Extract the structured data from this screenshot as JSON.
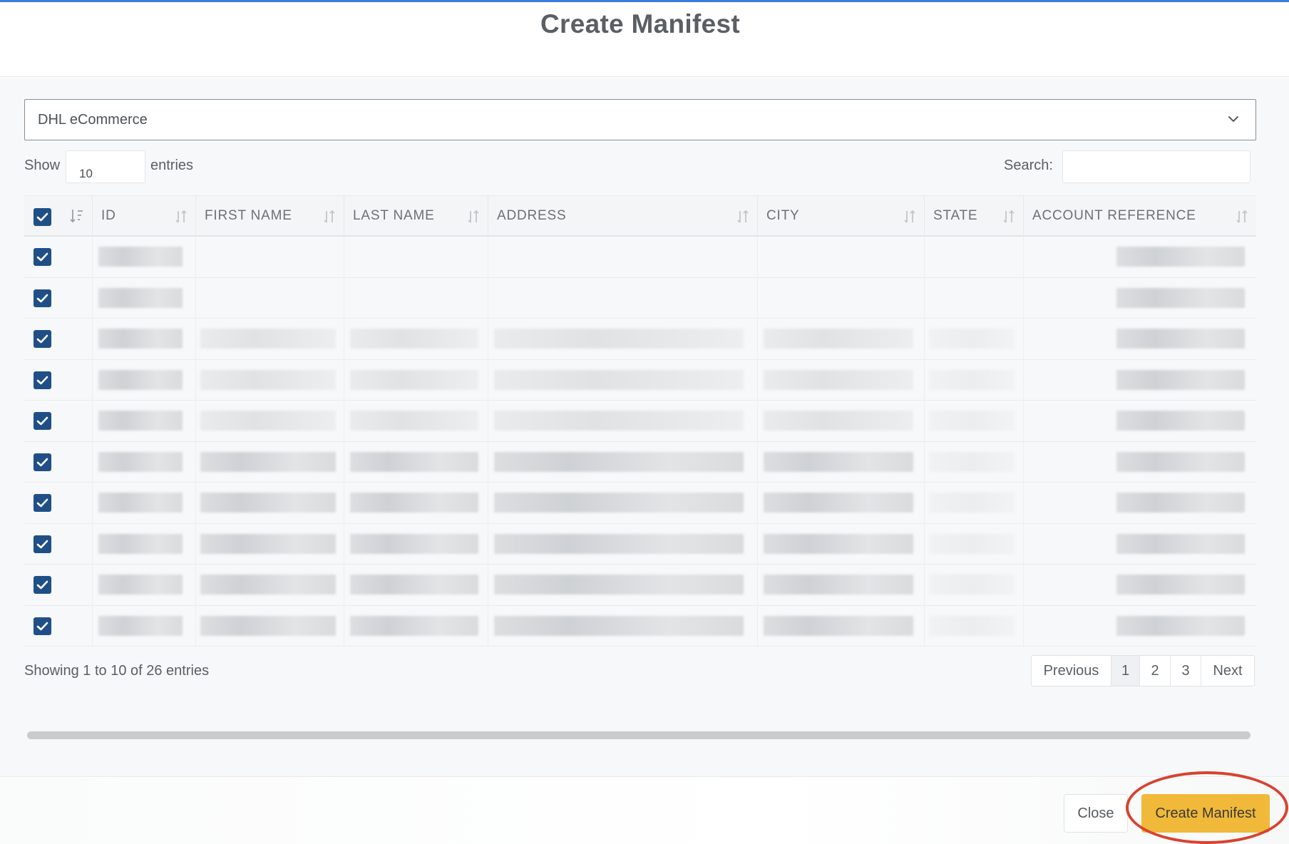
{
  "modal": {
    "title": "Create Manifest"
  },
  "carrier_select": {
    "selected": "DHL eCommerce",
    "icon": "chevron-down-icon"
  },
  "length_control": {
    "show_label": "Show",
    "value": "10",
    "entries_label": "entries"
  },
  "search": {
    "label": "Search:",
    "value": ""
  },
  "table": {
    "columns": [
      "ID",
      "FIRST NAME",
      "LAST NAME",
      "ADDRESS",
      "CITY",
      "STATE",
      "ACCOUNT REFERENCE"
    ],
    "select_all_checked": true,
    "rows_checked": [
      true,
      true,
      true,
      true,
      true,
      true,
      true,
      true,
      true,
      true
    ],
    "cell_content_note": ""
  },
  "pagination": {
    "info": "Showing 1 to 10 of 26 entries",
    "previous": "Previous",
    "pages": [
      "1",
      "2",
      "3"
    ],
    "current_page": "1",
    "next": "Next"
  },
  "footer": {
    "close_label": "Close",
    "create_label": "Create Manifest"
  },
  "colors": {
    "accent_button": "#f0b93a",
    "checkbox": "#1f4f86",
    "highlight_ring": "#d8422f",
    "top_border": "#3b7dd8"
  }
}
